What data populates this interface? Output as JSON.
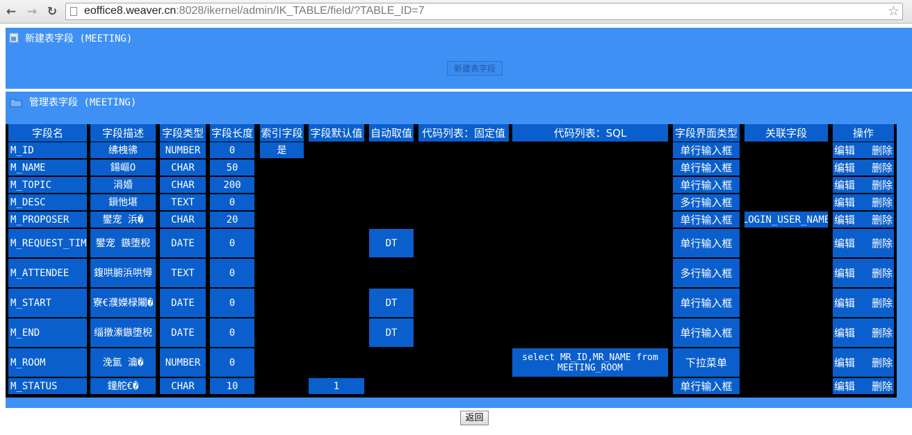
{
  "browser": {
    "url_host": "eoffice8.weaver.cn",
    "url_path": ":8028/ikernel/admin/IK_TABLE/field/?TABLE_ID=7"
  },
  "new_section": {
    "title": "新建表字段 (MEETING)",
    "button": "新建表字段"
  },
  "manage_section": {
    "title": "管理表字段 (MEETING)"
  },
  "table": {
    "headers": [
      "字段名",
      "字段描述",
      "字段类型",
      "字段长度",
      "索引字段",
      "字段默认值",
      "自动取值",
      "代码列表：固定值",
      "代码列表：SQL",
      "字段界面类型",
      "关联字段",
      "操作"
    ],
    "edit_label": "编辑",
    "delete_label": "删除",
    "rows": [
      {
        "name": "M_ID",
        "desc": "绋栧彿",
        "type": "NUMBER",
        "len": "0",
        "index": "是",
        "default": "",
        "auto": "",
        "code_fixed": "",
        "code_sql": "",
        "ui": "单行输入框",
        "related": ""
      },
      {
        "name": "M_NAME",
        "desc": "鍚嶇О",
        "type": "CHAR",
        "len": "50",
        "index": "",
        "default": "",
        "auto": "",
        "code_fixed": "",
        "code_sql": "",
        "ui": "单行输入框",
        "related": ""
      },
      {
        "name": "M_TOPIC",
        "desc": "涓婚",
        "type": "CHAR",
        "len": "200",
        "index": "",
        "default": "",
        "auto": "",
        "code_fixed": "",
        "code_sql": "",
        "ui": "单行输入框",
        "related": ""
      },
      {
        "name": "M_DESC",
        "desc": "鎻忚堪",
        "type": "TEXT",
        "len": "0",
        "index": "",
        "default": "",
        "auto": "",
        "code_fixed": "",
        "code_sql": "",
        "ui": "多行输入框",
        "related": ""
      },
      {
        "name": "M_PROPOSER",
        "desc": "鐢宠  浜�",
        "type": "CHAR",
        "len": "20",
        "index": "",
        "default": "",
        "auto": "",
        "code_fixed": "",
        "code_sql": "",
        "ui": "单行输入框",
        "related": "LOGIN_USER_NAME"
      },
      {
        "name": "M_REQUEST_TIME",
        "desc": "鐢宠  鏃堕棿",
        "type": "DATE",
        "len": "0",
        "index": "",
        "default": "",
        "auto": "DT",
        "code_fixed": "",
        "code_sql": "",
        "ui": "单行输入框",
        "related": ""
      },
      {
        "name": "M_ATTENDEE",
        "desc": "鍑哄腑浜哄憳",
        "type": "TEXT",
        "len": "0",
        "index": "",
        "default": "",
        "auto": "",
        "code_fixed": "",
        "code_sql": "",
        "ui": "多行输入框",
        "related": ""
      },
      {
        "name": "M_START",
        "desc": "寮€濮嬫椂闂�",
        "type": "DATE",
        "len": "0",
        "index": "",
        "default": "",
        "auto": "DT",
        "code_fixed": "",
        "code_sql": "",
        "ui": "单行输入框",
        "related": ""
      },
      {
        "name": "M_END",
        "desc": "缁撴潫鏃堕棿",
        "type": "DATE",
        "len": "0",
        "index": "",
        "default": "",
        "auto": "DT",
        "code_fixed": "",
        "code_sql": "",
        "ui": "单行输入框",
        "related": ""
      },
      {
        "name": "M_ROOM",
        "desc": "浼氳  瀹�",
        "type": "NUMBER",
        "len": "0",
        "index": "",
        "default": "",
        "auto": "",
        "code_fixed": "",
        "code_sql": "select MR_ID,MR_NAME from MEETING_ROOM",
        "ui": "下拉菜单",
        "related": ""
      },
      {
        "name": "M_STATUS",
        "desc": "鐘舵€�",
        "type": "CHAR",
        "len": "10",
        "index": "",
        "default": "1",
        "auto": "",
        "code_fixed": "",
        "code_sql": "",
        "ui": "单行输入框",
        "related": ""
      }
    ]
  },
  "back_button": "返回",
  "colors": {
    "panel": "#3f90f5",
    "cell": "#0a5fcc",
    "grid": "#000000"
  }
}
